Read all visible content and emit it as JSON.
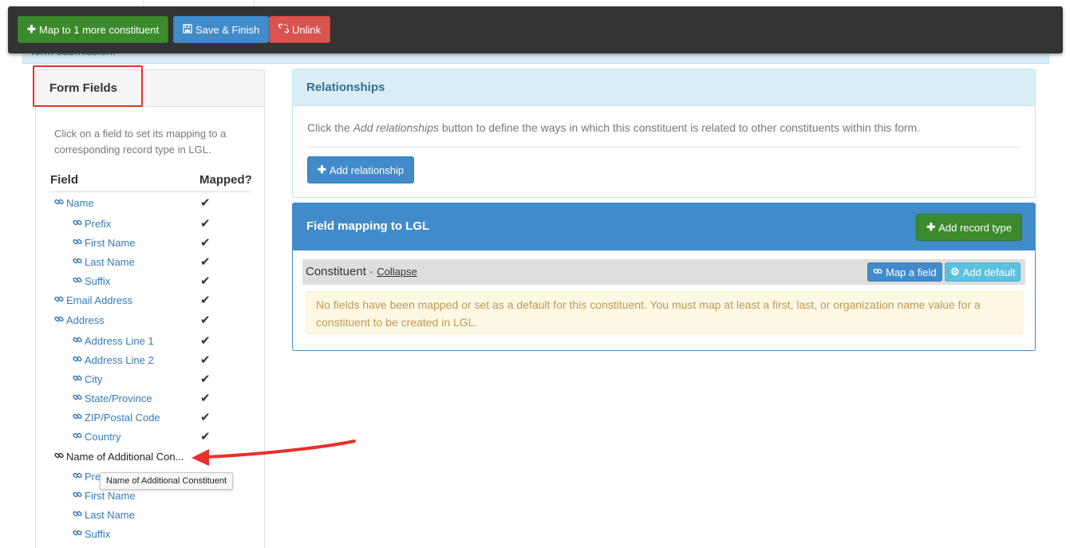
{
  "background": {
    "banner_text": "form submission."
  },
  "action_bar": {
    "map_more_label": "Map to 1 more constituent",
    "save_finish_label": "Save & Finish",
    "unlink_label": "Unlink"
  },
  "form_fields": {
    "title": "Form Fields",
    "help": "Click on a field to set its mapping to a corresponding record type in LGL.",
    "col_field": "Field",
    "col_mapped": "Mapped?",
    "rows": [
      {
        "label": "Name",
        "mapped": true
      },
      {
        "label": "Prefix",
        "mapped": true
      },
      {
        "label": "First Name",
        "mapped": true
      },
      {
        "label": "Last Name",
        "mapped": true
      },
      {
        "label": "Suffix",
        "mapped": true
      },
      {
        "label": "Email Address",
        "mapped": true
      },
      {
        "label": "Address",
        "mapped": true
      },
      {
        "label": "Address Line 1",
        "mapped": true
      },
      {
        "label": "Address Line 2",
        "mapped": true
      },
      {
        "label": "City",
        "mapped": true
      },
      {
        "label": "State/Province",
        "mapped": true
      },
      {
        "label": "ZIP/Postal Code",
        "mapped": true
      },
      {
        "label": "Country",
        "mapped": true
      },
      {
        "label": "Name of Additional Con...",
        "mapped": false
      },
      {
        "label": "Prefix",
        "mapped": false
      },
      {
        "label": "First Name",
        "mapped": false
      },
      {
        "label": "Last Name",
        "mapped": false
      },
      {
        "label": "Suffix",
        "mapped": false
      }
    ],
    "tooltip": "Name of Additional Constituent"
  },
  "relationships": {
    "title": "Relationships",
    "help_before": "Click the ",
    "help_em": "Add relationships",
    "help_after": " button to define the ways in which this constituent is related to other constituents within this form.",
    "add_label": "Add relationship"
  },
  "field_mapping": {
    "title": "Field mapping to LGL",
    "add_record_type_label": "Add record type",
    "constituent_label": "Constituent",
    "separator": " · ",
    "collapse_label": "Collapse",
    "map_field_label": "Map a field",
    "add_default_label": "Add default",
    "warning": "No fields have been mapped or set as a default for this constituent. You must map at least a first, last, or organization name value for a constituent to be created in LGL."
  },
  "colors": {
    "success": "#3c8a2e",
    "primary": "#428bca",
    "danger": "#d9534f",
    "info": "#5bc0de",
    "highlight": "#e8302a"
  },
  "icons": {
    "plus": "plus-icon",
    "save": "save-icon",
    "unlink": "unlink-icon",
    "link": "link-icon",
    "check": "check-icon",
    "gear": "gear-icon"
  }
}
